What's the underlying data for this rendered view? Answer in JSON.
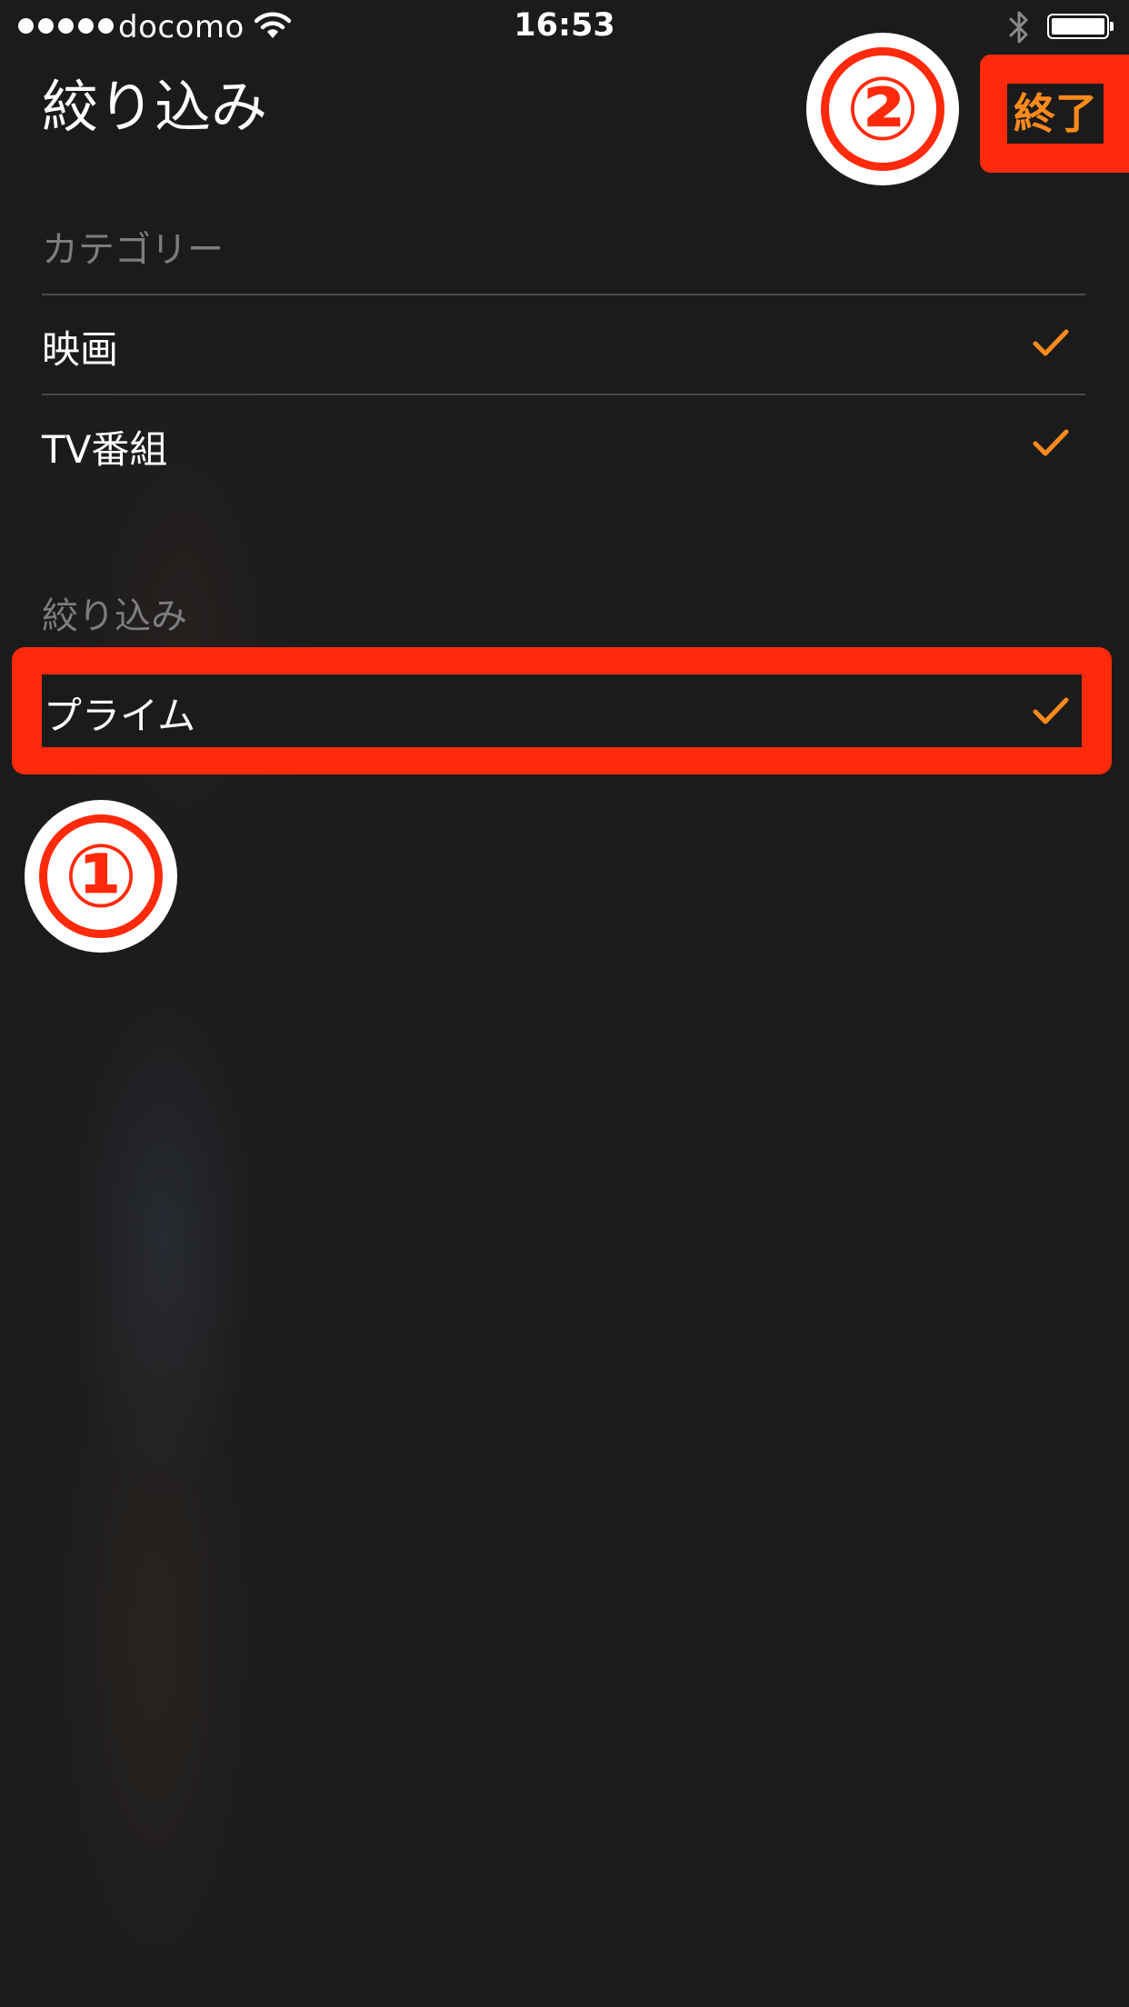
{
  "status_bar": {
    "carrier": "docomo",
    "time": "16:53",
    "signal_dots": 5,
    "icons": [
      "signal-dots",
      "wifi-icon",
      "bluetooth-icon",
      "battery-icon"
    ],
    "battery_level": 1.0
  },
  "header": {
    "title": "絞り込み",
    "done_label": "終了"
  },
  "sections": {
    "category": {
      "header": "カテゴリー",
      "items": [
        {
          "label": "映画",
          "checked": true
        },
        {
          "label": "TV番組",
          "checked": true
        }
      ]
    },
    "filter": {
      "header": "絞り込み",
      "items": [
        {
          "label": "プライム",
          "checked": true
        }
      ]
    }
  },
  "annotations": {
    "step_1": "①",
    "step_2": "②"
  },
  "colors": {
    "background": "#1b1b1b",
    "accent_orange": "#ff8a1c",
    "highlight_red": "#ff2a0c",
    "section_header_gray": "#7d7d7d",
    "divider": "#4a4a4a"
  }
}
